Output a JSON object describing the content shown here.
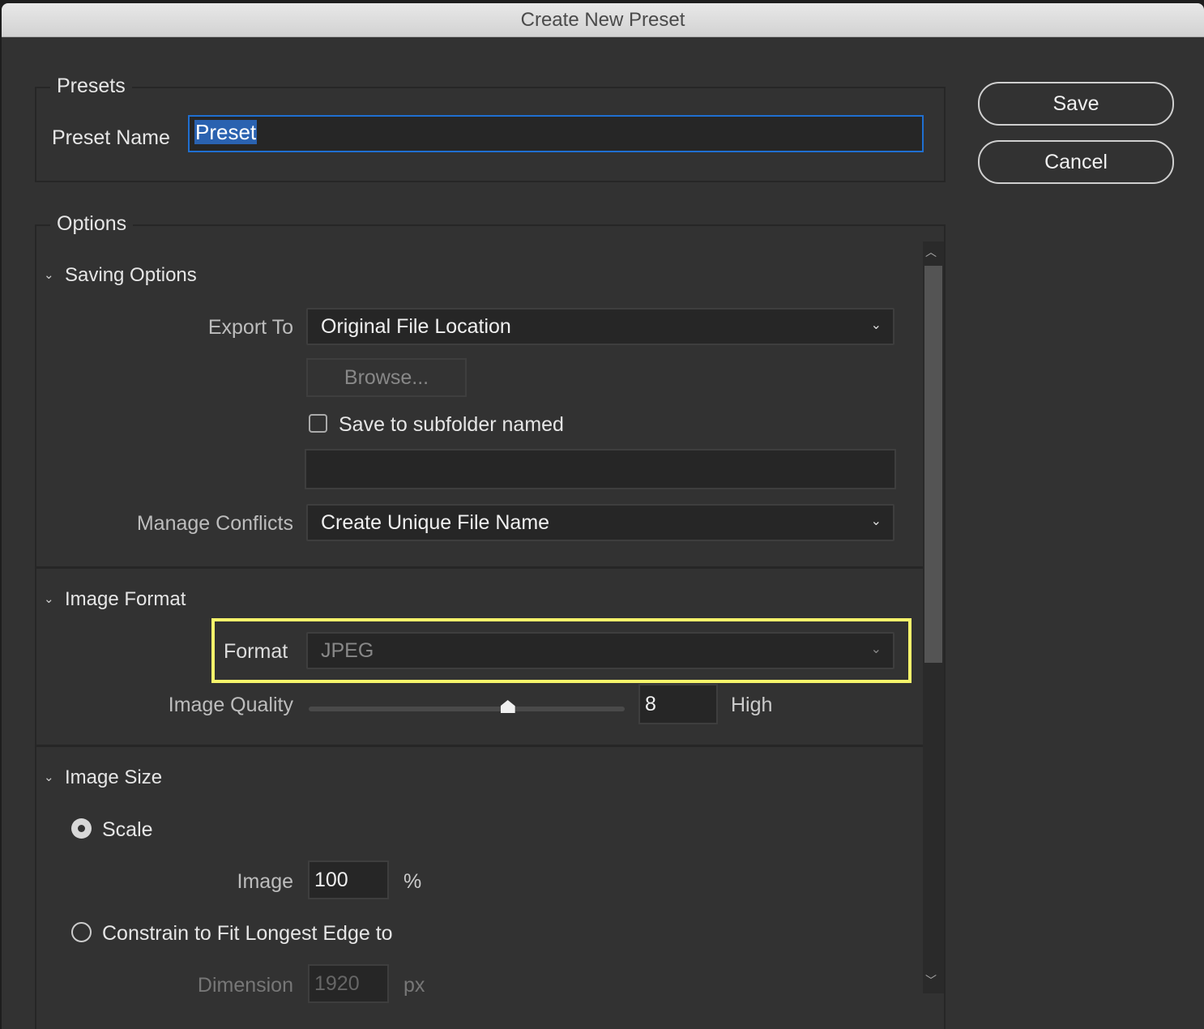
{
  "window": {
    "title": "Create New Preset"
  },
  "presets": {
    "legend": "Presets",
    "name_label": "Preset Name",
    "name_value": "Preset"
  },
  "actions": {
    "save": "Save",
    "cancel": "Cancel"
  },
  "options": {
    "legend": "Options",
    "saving": {
      "title": "Saving Options",
      "export_label": "Export To",
      "export_value": "Original File Location",
      "browse": "Browse...",
      "subfolder_label": "Save to subfolder named",
      "subfolder_checked": false,
      "subfolder_value": "",
      "conflicts_label": "Manage Conflicts",
      "conflicts_value": "Create Unique File Name"
    },
    "format": {
      "title": "Image Format",
      "format_label": "Format",
      "format_value": "JPEG",
      "quality_label": "Image Quality",
      "quality_value": "8",
      "quality_slider_fraction": 0.63,
      "quality_text": "High"
    },
    "size": {
      "title": "Image Size",
      "scale_label": "Scale",
      "scale_selected": true,
      "image_label": "Image",
      "image_value": "100",
      "percent": "%",
      "constrain_label": "Constrain to Fit Longest Edge to",
      "dimension_label": "Dimension",
      "dimension_value": "1920",
      "px": "px"
    }
  },
  "colors": {
    "highlight": "#f7f56b",
    "focus": "#1f6fd1"
  }
}
